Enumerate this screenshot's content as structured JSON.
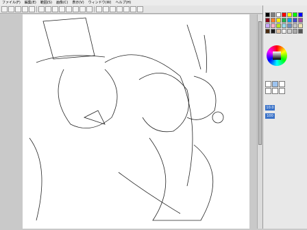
{
  "menu": [
    "ファイル(F)",
    "編集(E)",
    "範囲(S)",
    "画像(C)",
    "表示(V)",
    "ウィンドウ(W)",
    "ヘルプ(H)"
  ],
  "toolbar_icons": [
    "new-file",
    "open",
    "save",
    "undo",
    "redo",
    "select",
    "lasso",
    "move",
    "zoom",
    "rotate-left",
    "rotate-right",
    "flip",
    "hand",
    "eyedropper",
    "fill",
    "pen",
    "eraser",
    "text",
    "color-fg",
    "color-bg"
  ],
  "panel": {
    "swatch_colors": [
      "#000000",
      "#7f7f7f",
      "#ffffff",
      "#ff0000",
      "#ffff00",
      "#00ff00",
      "#0000ff",
      "#880015",
      "#ff7f27",
      "#fff200",
      "#22b14c",
      "#00a2e8",
      "#3f48cc",
      "#a349a4",
      "#c8a8ff",
      "#ffaec9",
      "#b5e61d",
      "#99d9ea",
      "#7092be",
      "#c3c3c3",
      "#efe4b0",
      "#4a2a10",
      "#1b1b1b",
      "#e0c0a0",
      "#f0f0f0",
      "#d0d0d0",
      "#aaaaaa",
      "#555555"
    ],
    "brush_size": "10.0",
    "opacity": "100"
  }
}
